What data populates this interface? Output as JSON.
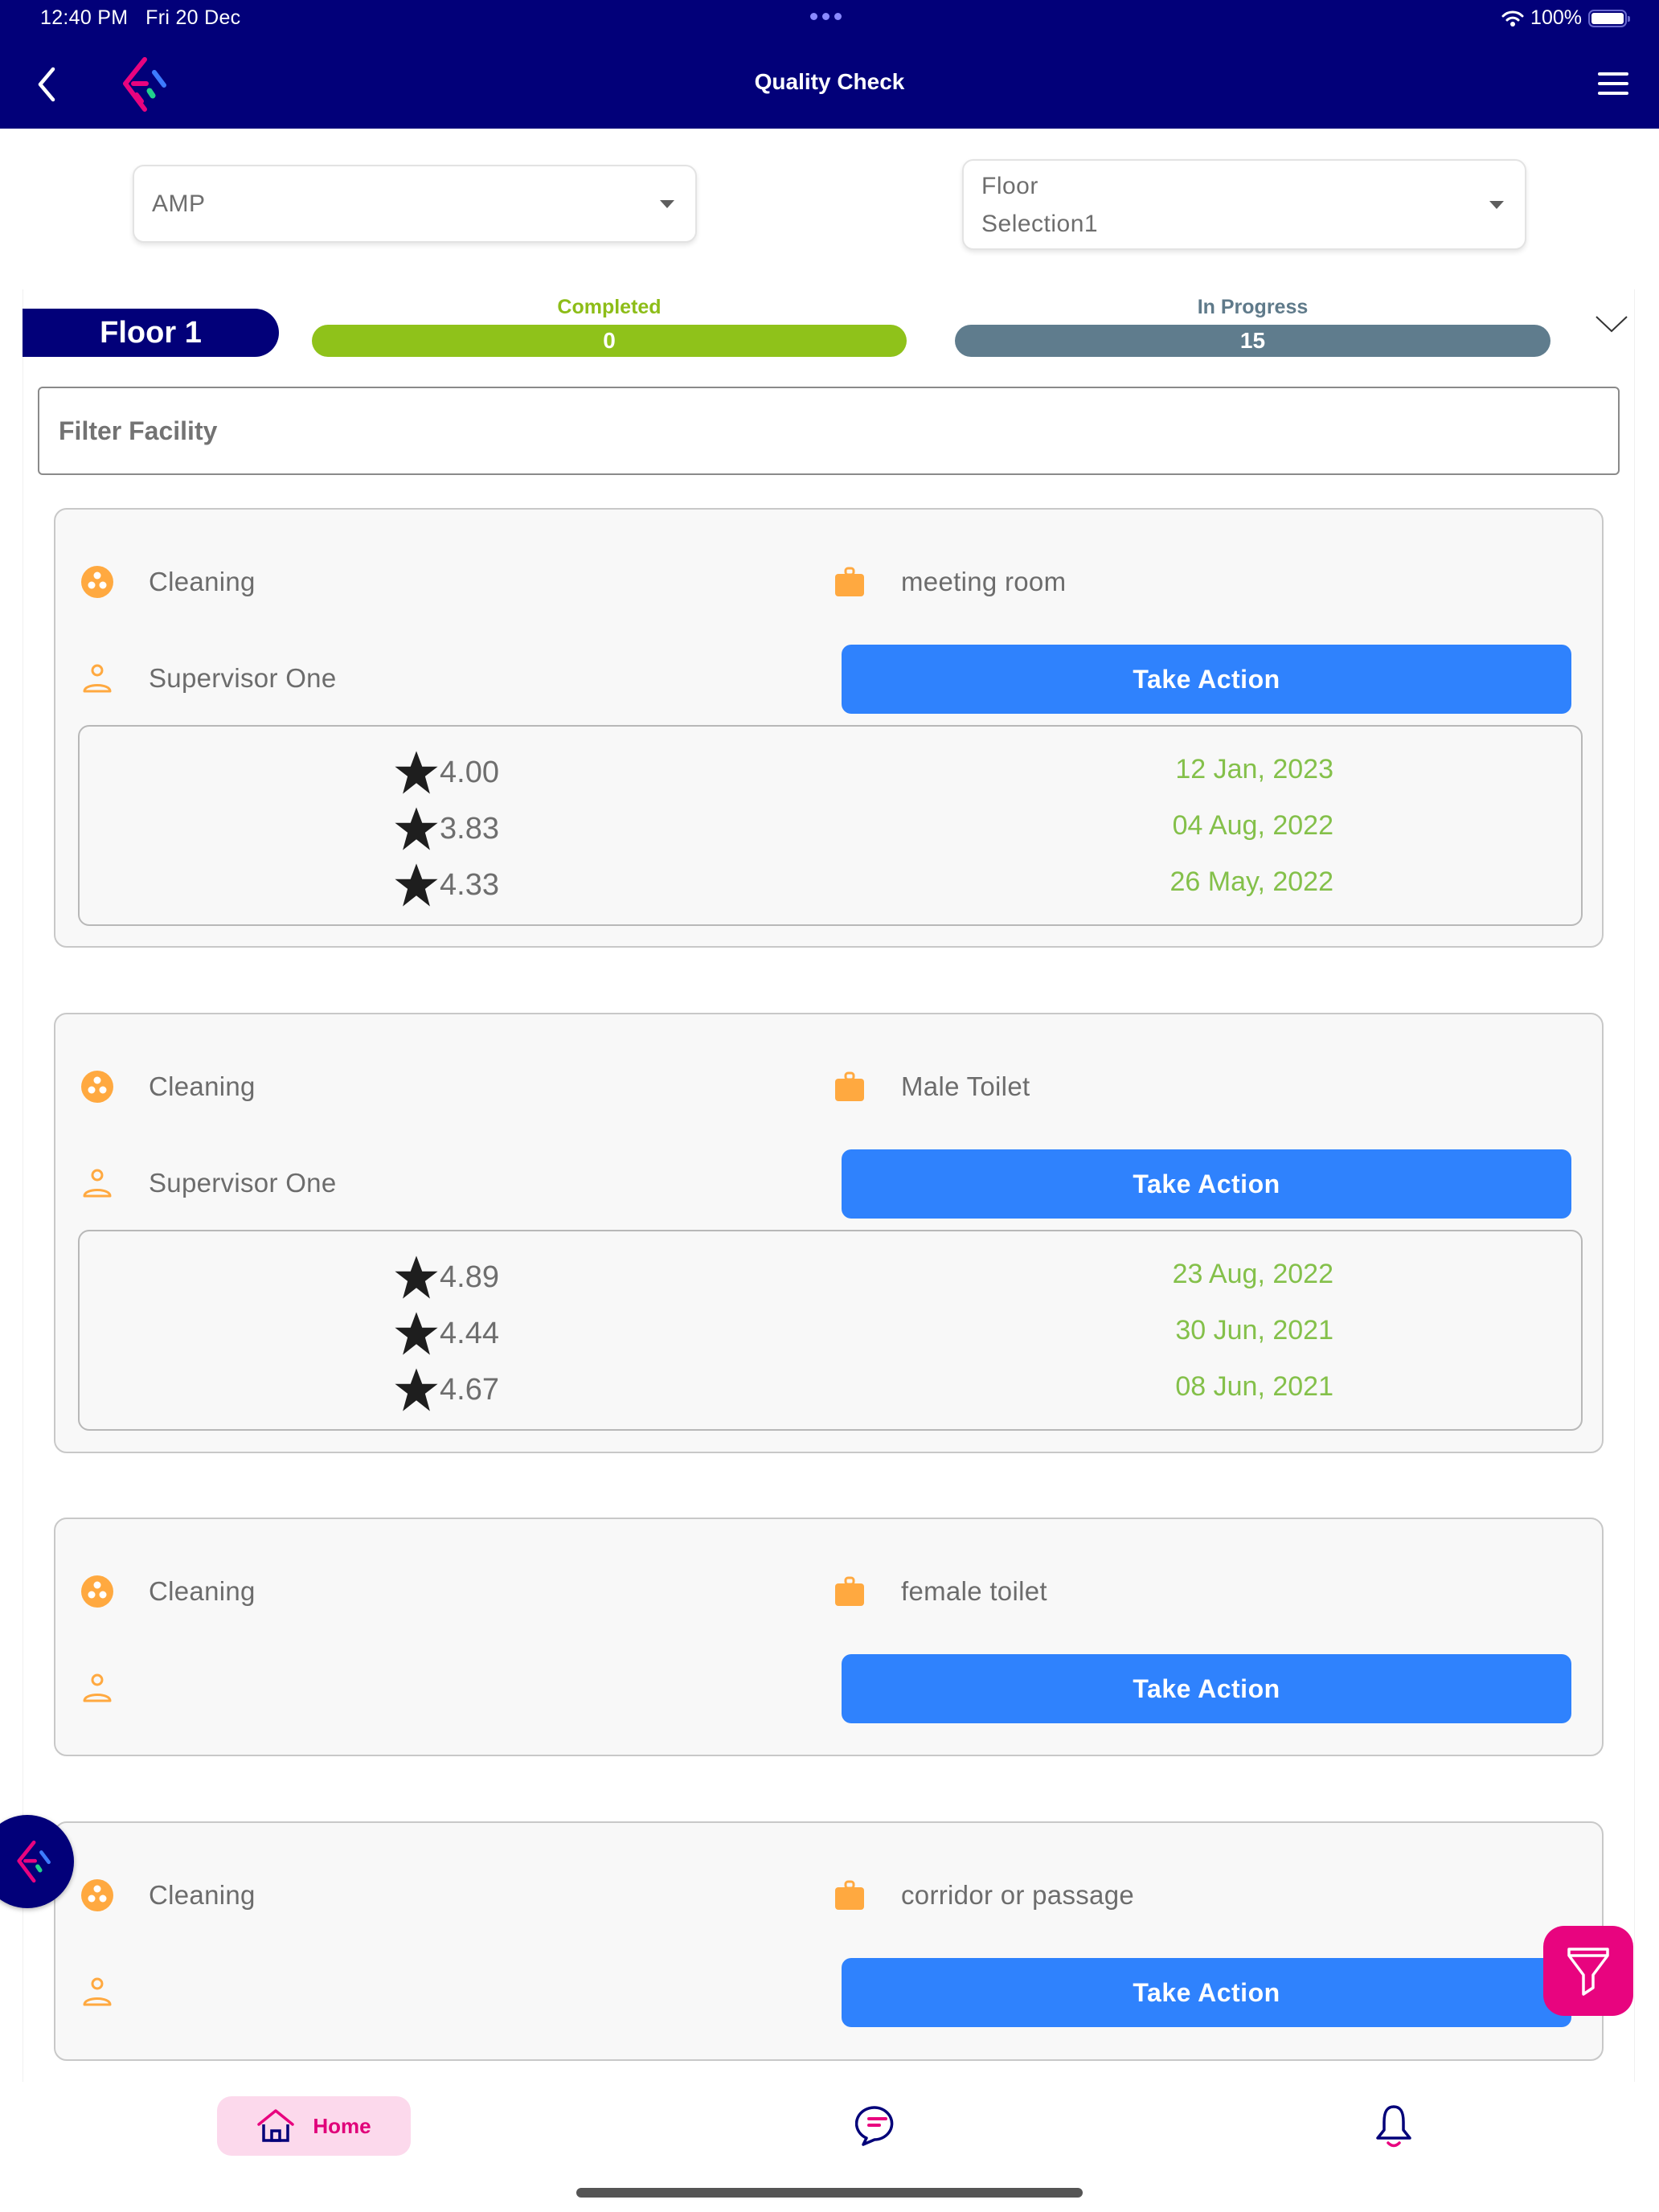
{
  "status_bar": {
    "time": "12:40 PM",
    "date": "Fri 20 Dec",
    "battery": "100%"
  },
  "header": {
    "title": "Quality Check",
    "back_icon": "chevron-left-icon",
    "menu_icon": "hamburger-menu-icon",
    "logo": "app-logo"
  },
  "filters": {
    "site_dropdown": {
      "selected": "AMP"
    },
    "floor_dropdown": {
      "selected": "Floor Selection1",
      "line1": "Floor",
      "line2": "Selection1"
    }
  },
  "summary": {
    "floor_label": "Floor 1",
    "completed": {
      "label": "Completed",
      "value": "0"
    },
    "in_progress": {
      "label": "In Progress",
      "value": "15"
    }
  },
  "filter_facility": {
    "placeholder": "Filter Facility"
  },
  "cards": [
    {
      "service": "Cleaning",
      "location": "meeting room",
      "supervisor": "Supervisor One",
      "action_label": "Take Action",
      "history": [
        {
          "rating": "4.00",
          "date": "12 Jan, 2023"
        },
        {
          "rating": "3.83",
          "date": "04 Aug, 2022"
        },
        {
          "rating": "4.33",
          "date": "26 May, 2022"
        }
      ]
    },
    {
      "service": "Cleaning",
      "location": "Male Toilet",
      "supervisor": "Supervisor One",
      "action_label": "Take Action",
      "history": [
        {
          "rating": "4.89",
          "date": "23 Aug, 2022"
        },
        {
          "rating": "4.44",
          "date": "30 Jun, 2021"
        },
        {
          "rating": "4.67",
          "date": "08 Jun, 2021"
        }
      ]
    },
    {
      "service": "Cleaning",
      "location": "female toilet",
      "supervisor": "",
      "action_label": "Take Action",
      "history": []
    },
    {
      "service": "Cleaning",
      "location": "corridor or passage",
      "supervisor": "",
      "action_label": "Take Action",
      "history": []
    }
  ],
  "bottom_nav": {
    "home_label": "Home",
    "items": [
      "home-icon",
      "chat-icon",
      "bell-icon"
    ]
  },
  "colors": {
    "brand_navy": "#020079",
    "brand_pink": "#e8047f",
    "action_blue": "#2f82fd",
    "completed_green": "#8fc21a",
    "in_progress_slate": "#5f7c8d",
    "date_green": "#84c04a",
    "icon_orange": "#ffa940"
  }
}
